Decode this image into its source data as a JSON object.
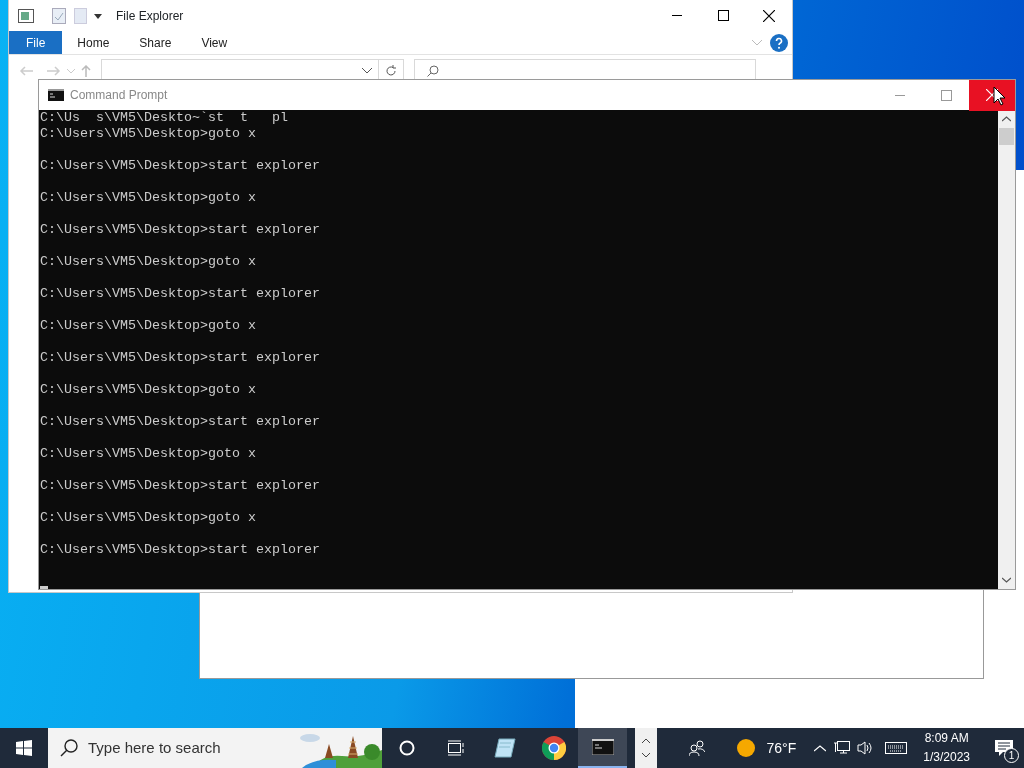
{
  "file_explorer": {
    "title": "File Explorer",
    "tabs": [
      {
        "label": "File",
        "selected": true
      },
      {
        "label": "Home",
        "selected": false
      },
      {
        "label": "Share",
        "selected": false
      },
      {
        "label": "View",
        "selected": false
      }
    ]
  },
  "command_prompt": {
    "title": "Command Prompt",
    "close_hovered": true,
    "lines": [
      {
        "kind": "output",
        "text": "C:\\Us  s\\VM5\\Deskto~`st  t   pl"
      },
      {
        "kind": "command",
        "text": "C:\\Users\\VM5\\Desktop>goto x"
      },
      {
        "kind": "command",
        "text": "C:\\Users\\VM5\\Desktop>start explorer"
      },
      {
        "kind": "command",
        "text": "C:\\Users\\VM5\\Desktop>goto x"
      },
      {
        "kind": "command",
        "text": "C:\\Users\\VM5\\Desktop>start explorer"
      },
      {
        "kind": "command",
        "text": "C:\\Users\\VM5\\Desktop>goto x"
      },
      {
        "kind": "command",
        "text": "C:\\Users\\VM5\\Desktop>start explorer"
      },
      {
        "kind": "command",
        "text": "C:\\Users\\VM5\\Desktop>goto x"
      },
      {
        "kind": "command",
        "text": "C:\\Users\\VM5\\Desktop>start explorer"
      },
      {
        "kind": "command",
        "text": "C:\\Users\\VM5\\Desktop>goto x"
      },
      {
        "kind": "command",
        "text": "C:\\Users\\VM5\\Desktop>start explorer"
      },
      {
        "kind": "command",
        "text": "C:\\Users\\VM5\\Desktop>goto x"
      },
      {
        "kind": "command",
        "text": "C:\\Users\\VM5\\Desktop>start explorer"
      },
      {
        "kind": "command",
        "text": "C:\\Users\\VM5\\Desktop>goto x"
      },
      {
        "kind": "command",
        "text": "C:\\Users\\VM5\\Desktop>start explorer"
      },
      {
        "kind": "cursor"
      }
    ]
  },
  "taskbar": {
    "search": {
      "placeholder": "Type here to search"
    },
    "apps": [
      {
        "kind": "cortana",
        "selected": false
      },
      {
        "kind": "task-view",
        "selected": false
      },
      {
        "kind": "notepad",
        "selected": false
      },
      {
        "kind": "chrome",
        "selected": false
      },
      {
        "kind": "console",
        "selected": true
      }
    ],
    "weather": {
      "temperature": "76°F"
    },
    "clock": {
      "time": "8:09 AM",
      "date": "1/3/2023"
    },
    "notifications": {
      "count": "1"
    }
  }
}
